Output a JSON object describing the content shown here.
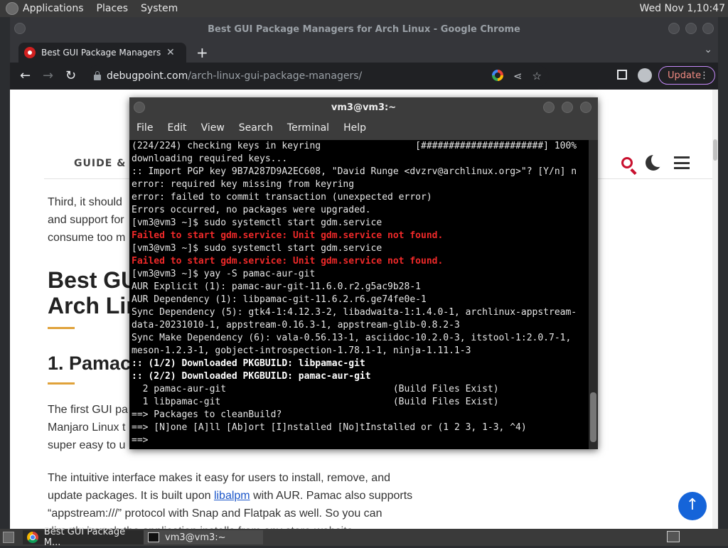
{
  "top_panel": {
    "menus": [
      "Applications",
      "Places",
      "System"
    ],
    "clock": "Wed Nov 1,10:47"
  },
  "chrome": {
    "window_title": "Best GUI Package Managers for Arch Linux - Google Chrome",
    "tab_title": "Best GUI Package Managers fo",
    "url_host": "debugpoint.com",
    "url_path": "/arch-linux-gui-package-managers/",
    "update_label": "Update"
  },
  "webpage": {
    "nav_label": "GUIDE & R",
    "para1": [
      "Third, it should",
      "and support for",
      "consume too m"
    ],
    "heading": [
      "Best GU",
      "Arch Lin"
    ],
    "section_heading": "1. Pamac",
    "para2": [
      "The first GUI pa",
      "Manjaro Linux t",
      "super easy to u"
    ],
    "para3_line1": "The intuitive interface makes it easy for users to install, remove, and",
    "para3_line2_pre": "update packages. It is built upon ",
    "para3_link": "libalpm",
    "para3_line2_post": " with AUR. Pamac also supports",
    "para3_line3": "“appstream:///” protocol with Snap and Flatpak as well. So you can",
    "para3_line4": "directly launch the application installs from any store-website..."
  },
  "terminal": {
    "title": "vm3@vm3:~",
    "menus": [
      "File",
      "Edit",
      "View",
      "Search",
      "Terminal",
      "Help"
    ],
    "lines": [
      "(224/224) checking keys in keyring                 [######################] 100%",
      "downloading required keys...",
      ":: Import PGP key 9B7A287D9A2EC608, \"David Runge <dvzrv@archlinux.org>\"? [Y/n] n",
      "error: required key missing from keyring",
      "error: failed to commit transaction (unexpected error)",
      "Errors occurred, no packages were upgraded.",
      "[vm3@vm3 ~]$ sudo systemctl start gdm.service",
      "Failed to start gdm.service: Unit gdm.service not found.",
      "[vm3@vm3 ~]$ sudo systemctl start gdm.service",
      "Failed to start gdm.service: Unit gdm.service not found.",
      "[vm3@vm3 ~]$ yay -S pamac-aur-git",
      "AUR Explicit (1): pamac-aur-git-11.6.0.r2.g5ac9b28-1",
      "AUR Dependency (1): libpamac-git-11.6.2.r6.ge74fe0e-1",
      "Sync Dependency (5): gtk4-1:4.12.3-2, libadwaita-1:1.4.0-1, archlinux-appstream-",
      "data-20231010-1, appstream-0.16.3-1, appstream-glib-0.8.2-3",
      "Sync Make Dependency (6): vala-0.56.13-1, asciidoc-10.2.0-3, itstool-1:2.0.7-1,",
      "meson-1.2.3-1, gobject-introspection-1.78.1-1, ninja-1.11.1-3",
      ":: (1/2) Downloaded PKGBUILD: libpamac-git",
      ":: (2/2) Downloaded PKGBUILD: pamac-aur-git",
      "  2 pamac-aur-git                              (Build Files Exist)",
      "  1 libpamac-git                               (Build Files Exist)",
      "==> Packages to cleanBuild?",
      "==> [N]one [A]ll [Ab]ort [I]nstalled [No]tInstalled or (1 2 3, 1-3, ^4)",
      "==> "
    ],
    "red_line_indexes": [
      7,
      9
    ],
    "bold_line_indexes": [
      17,
      18
    ]
  },
  "taskbar": {
    "items": [
      "Best GUI Package M...",
      "vm3@vm3:~"
    ]
  },
  "colors": {
    "accent_red": "#c8102e",
    "link_blue": "#1a55c9",
    "scroll_top_blue": "#1564d9",
    "terminal_error_red": "#ef2929"
  }
}
